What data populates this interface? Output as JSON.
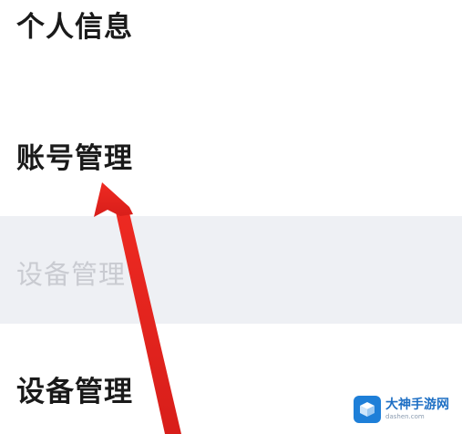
{
  "menu": {
    "personal_info": "个人信息",
    "account_management": "账号管理",
    "device_management_pressed": "设备管理",
    "device_management": "设备管理"
  },
  "watermark": {
    "name": "大神手游网",
    "sub": "dashen.com"
  },
  "colors": {
    "arrow": "#e8231f",
    "pressed_background": "#eef0f4",
    "watermark_brand": "#1e7fd8"
  }
}
